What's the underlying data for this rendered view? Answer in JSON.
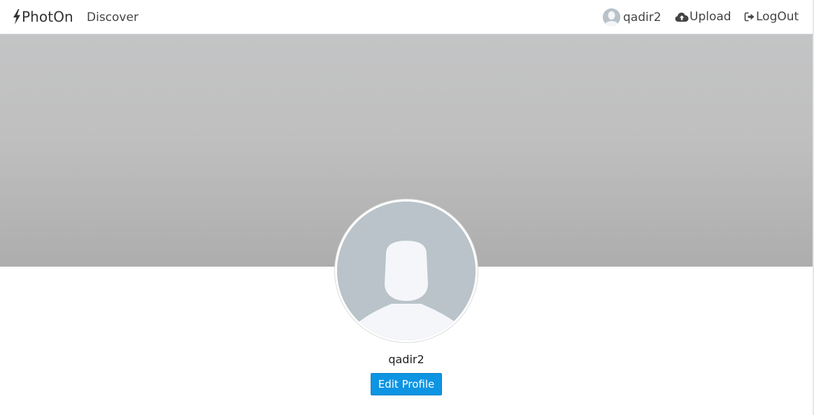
{
  "navbar": {
    "brand": {
      "icon": "bolt-icon",
      "label": "PhotOn"
    },
    "discover_label": "Discover",
    "user": {
      "icon": "avatar-icon",
      "label": "qadir2"
    },
    "upload": {
      "icon": "cloud-upload-icon",
      "label": "Upload"
    },
    "logout": {
      "icon": "sign-out-icon",
      "label": "LogOut"
    }
  },
  "profile": {
    "avatar_icon": "default-user-avatar-icon",
    "username": "qadir2",
    "edit_button_label": "Edit Profile"
  },
  "colors": {
    "accent": "#0d94e3",
    "cover_top": "#c3c4c5",
    "cover_bottom": "#adadad",
    "avatar_bg": "#b9c3c9",
    "avatar_silhouette": "#f4f6f9"
  }
}
